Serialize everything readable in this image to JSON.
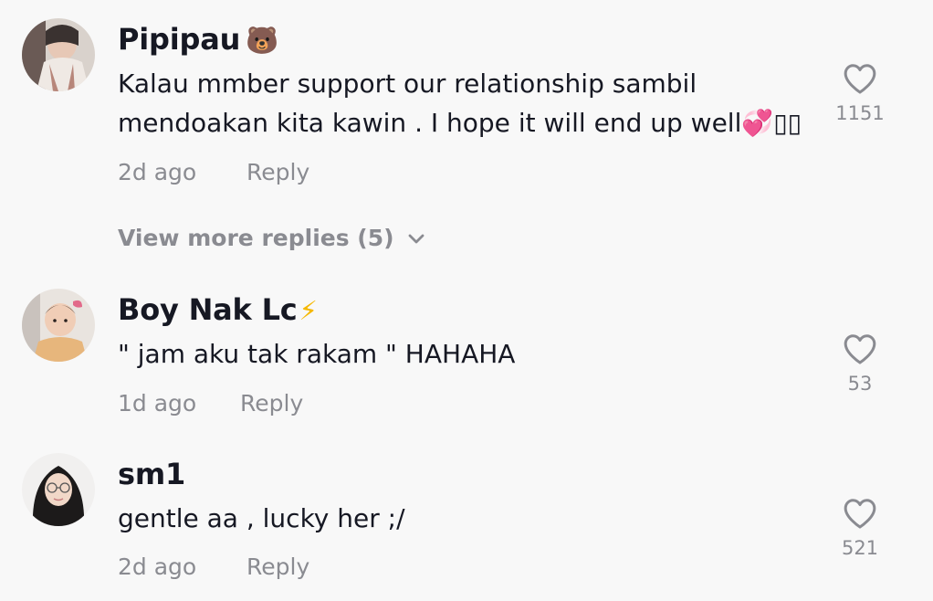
{
  "comments": [
    {
      "username": "Pipipau",
      "username_emoji": "🐻",
      "text_line1": "Kalau mmber support our relationship sambil",
      "text_line2": "mendoakan kita kawin . I hope it will end up well💞▯▯",
      "time": "2d ago",
      "reply_label": "Reply",
      "likes": "1151",
      "view_more_label": "View more replies (5)"
    },
    {
      "username": "Boy Nak Lc",
      "username_emoji": "⚡",
      "text_line1": "\" jam aku tak rakam \" HAHAHA",
      "time": "1d ago",
      "reply_label": "Reply",
      "likes": "53"
    },
    {
      "username": "sm1",
      "text_line1": "gentle aa , lucky her ;/",
      "time": "2d ago",
      "reply_label": "Reply",
      "likes": "521"
    }
  ],
  "icons": {
    "like": "heart-outline-icon",
    "expand": "chevron-down-icon"
  },
  "colors": {
    "background": "#f8f8f8",
    "primary_text": "#161823",
    "secondary_text": "#8a8b91"
  }
}
